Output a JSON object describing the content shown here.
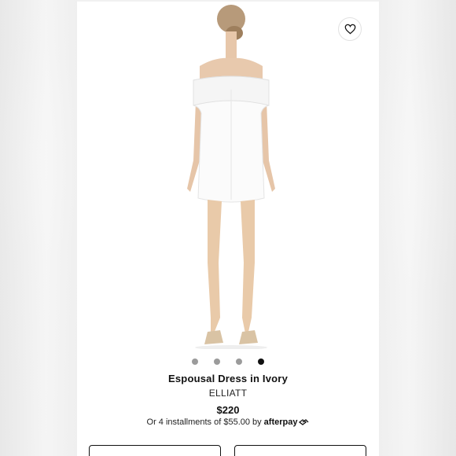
{
  "product": {
    "title": "Espousal Dress in Ivory",
    "brand": "ELLIATT",
    "price": "$220",
    "installments_text": "Or 4 installments of $55.00 by",
    "afterpay_label": "afterpay",
    "favorite_icon": "heart-icon"
  },
  "gallery": {
    "image_count": 4,
    "active_index": 3
  },
  "buttons": [
    {
      "label": ""
    },
    {
      "label": ""
    }
  ]
}
